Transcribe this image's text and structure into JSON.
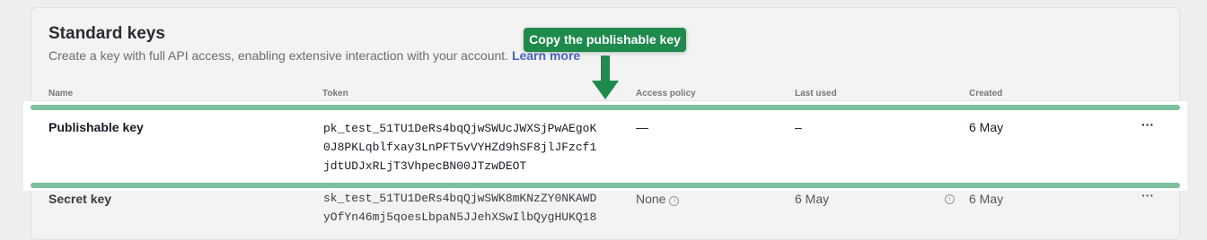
{
  "section": {
    "title": "Standard keys",
    "subtitle": "Create a key with full API access, enabling extensive interaction with your account.",
    "learn_more": "Learn more"
  },
  "tooltip": {
    "text": "Copy the publishable key"
  },
  "columns": {
    "name": "Name",
    "token": "Token",
    "access_policy": "Access policy",
    "last_used": "Last used",
    "created": "Created"
  },
  "rows": [
    {
      "name": "Publishable key",
      "token_lines": [
        "pk_test_51TU1DeRs4bqQjwSWUcJWXSjPwAEgoK",
        "0J8PKLqblfxay3LnPFT5vVYHZd9hSF8jlJFzcf1",
        "jdtUDJxRLjT3VhpecBN00JTzwDEOT"
      ],
      "access_policy": "—",
      "last_used": "–",
      "created": "6 May",
      "menu": "···"
    },
    {
      "name": "Secret key",
      "token_lines": [
        "sk_test_51TU1DeRs4bqQjwSWK8mKNzZY0NKAWD",
        "yOfYn46mj5qoesLbpaN5JJehXSwIlbQygHUKQ18"
      ],
      "access_policy": "None",
      "last_used": "6 May",
      "created": "6 May",
      "menu": "···"
    }
  ],
  "colors": {
    "tooltip_bg": "#1e8a4c",
    "highlight_bar": "#7dbf9f",
    "link": "#4a62c9"
  },
  "icons": {
    "info": "info-circle-icon",
    "arrow": "arrow-down-icon",
    "menu": "more-horizontal-icon"
  }
}
